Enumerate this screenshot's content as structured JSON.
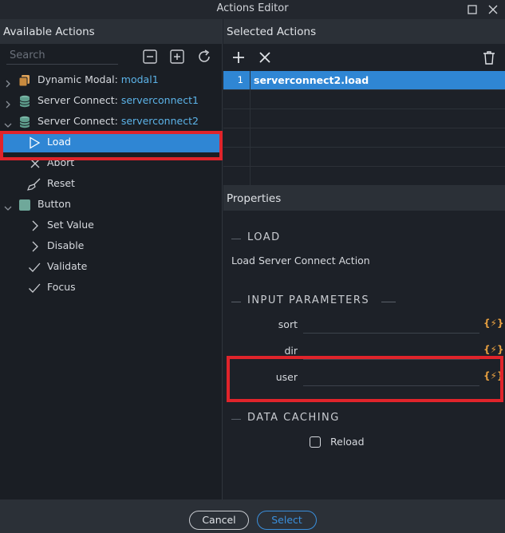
{
  "window": {
    "title": "Actions Editor"
  },
  "left": {
    "header": "Available Actions",
    "search": {
      "placeholder": "Search",
      "value": ""
    },
    "tree": [
      {
        "label": "Dynamic Modal:",
        "value": "modal1"
      },
      {
        "label": "Server Connect:",
        "value": "serverconnect1"
      },
      {
        "label": "Server Connect:",
        "value": "serverconnect2"
      },
      {
        "label": "Load"
      },
      {
        "label": "Abort"
      },
      {
        "label": "Reset"
      },
      {
        "label": "Button"
      },
      {
        "label": "Set Value"
      },
      {
        "label": "Disable"
      },
      {
        "label": "Validate"
      },
      {
        "label": "Focus"
      }
    ]
  },
  "selected": {
    "header": "Selected Actions",
    "rows": [
      {
        "num": "1",
        "action": "serverconnect2.load"
      }
    ]
  },
  "properties": {
    "header": "Properties",
    "sections": {
      "load": "LOAD",
      "input": "INPUT PARAMETERS",
      "caching": "DATA CACHING"
    },
    "description": "Load Server Connect Action",
    "params": [
      {
        "label": "sort",
        "value": "",
        "btn": "{⚡}"
      },
      {
        "label": "dir",
        "value": "",
        "btn": "{⚡}"
      },
      {
        "label": "user",
        "value": "",
        "btn": "{⚡}"
      }
    ],
    "reload_label": "Reload"
  },
  "footer": {
    "cancel": "Cancel",
    "select": "Select"
  },
  "colors": {
    "accent": "#2f86d4",
    "highlight": "#e0242b",
    "dynamic": "#e8a040"
  }
}
